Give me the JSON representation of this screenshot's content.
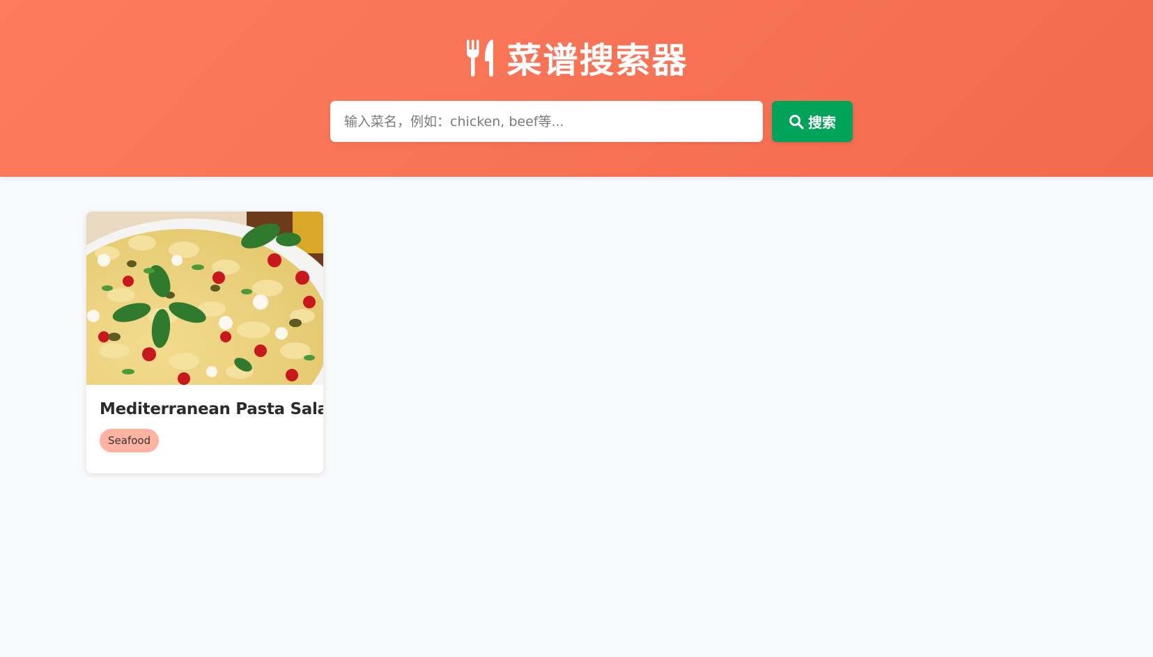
{
  "header": {
    "title": "菜谱搜索器",
    "icon": "utensils-icon",
    "gradient_start": "#ff7b5c",
    "gradient_end": "#f26a4e"
  },
  "search": {
    "placeholder": "输入菜名，例如：chicken, beef等...",
    "value": "",
    "button_label": "搜索",
    "button_icon": "search-icon",
    "button_color": "#00a35a"
  },
  "results": [
    {
      "name": "Mediterranean Pasta Salad",
      "category": "Seafood",
      "image_icon": "pasta-salad-photo"
    }
  ],
  "colors": {
    "badge": "#ffb3a0",
    "background": "#f8f9fa"
  }
}
